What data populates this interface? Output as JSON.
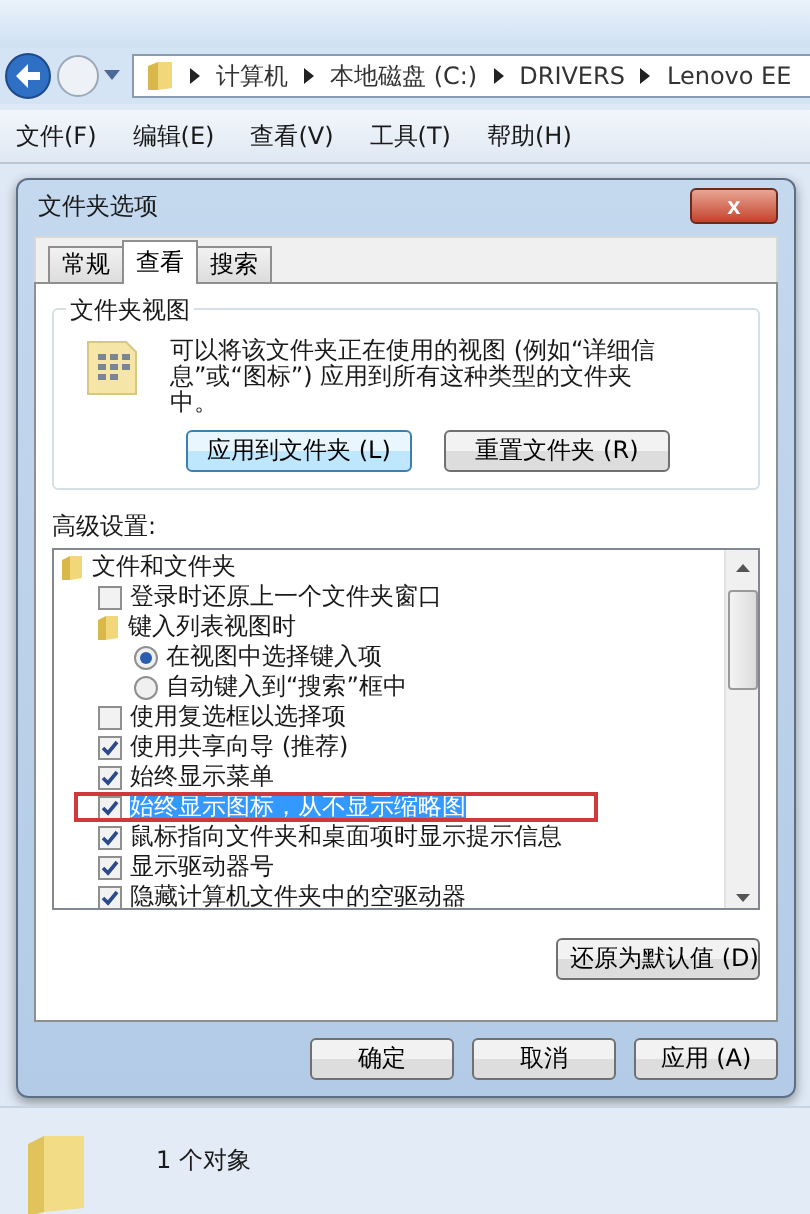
{
  "explorer": {
    "breadcrumb": [
      "计算机",
      "本地磁盘 (C:)",
      "DRIVERS",
      "Lenovo EE"
    ],
    "menu": [
      "文件(F)",
      "编辑(E)",
      "查看(V)",
      "工具(T)",
      "帮助(H)"
    ],
    "status": "1 个对象"
  },
  "dialog": {
    "title": "文件夹选项",
    "close": "x",
    "tabs": [
      {
        "label": "常规",
        "selected": false
      },
      {
        "label": "查看",
        "selected": true
      },
      {
        "label": "搜索",
        "selected": false
      }
    ],
    "folder_views": {
      "title": "文件夹视图",
      "description": "可以将该文件夹正在使用的视图 (例如“详细信息”或“图标”) 应用到所有这种类型的文件夹中。",
      "buttons": [
        "应用到文件夹 (L)",
        "重置文件夹 (R)"
      ]
    },
    "advanced_label": "高级设置:",
    "settings": [
      {
        "kind": "folder",
        "label": "文件和文件夹",
        "children": [
          {
            "kind": "checkbox",
            "label": "登录时还原上一个文件夹窗口",
            "checked": false,
            "selected": false
          },
          {
            "kind": "folder",
            "label": "键入列表视图时",
            "children": [
              {
                "kind": "radio",
                "label": "在视图中选择键入项",
                "checked": true,
                "selected": false
              },
              {
                "kind": "radio",
                "label": "自动键入到“搜索”框中",
                "checked": false,
                "selected": false
              }
            ]
          },
          {
            "kind": "checkbox",
            "label": "使用复选框以选择项",
            "checked": false,
            "selected": false
          },
          {
            "kind": "checkbox",
            "label": "使用共享向导 (推荐)",
            "checked": true,
            "selected": false
          },
          {
            "kind": "checkbox",
            "label": "始终显示菜单",
            "checked": true,
            "selected": false
          },
          {
            "kind": "checkbox",
            "label": "始终显示图标，从不显示缩略图",
            "checked": true,
            "selected": true
          },
          {
            "kind": "checkbox",
            "label": "鼠标指向文件夹和桌面项时显示提示信息",
            "checked": true,
            "selected": false
          },
          {
            "kind": "checkbox",
            "label": "显示驱动器号",
            "checked": true,
            "selected": false
          },
          {
            "kind": "checkbox",
            "label": "隐藏计算机文件夹中的空驱动器",
            "checked": true,
            "selected": false
          }
        ]
      }
    ],
    "restore_button": "还原为默认值 (D)",
    "buttons": [
      "确定",
      "取消",
      "应用 (A)"
    ]
  }
}
